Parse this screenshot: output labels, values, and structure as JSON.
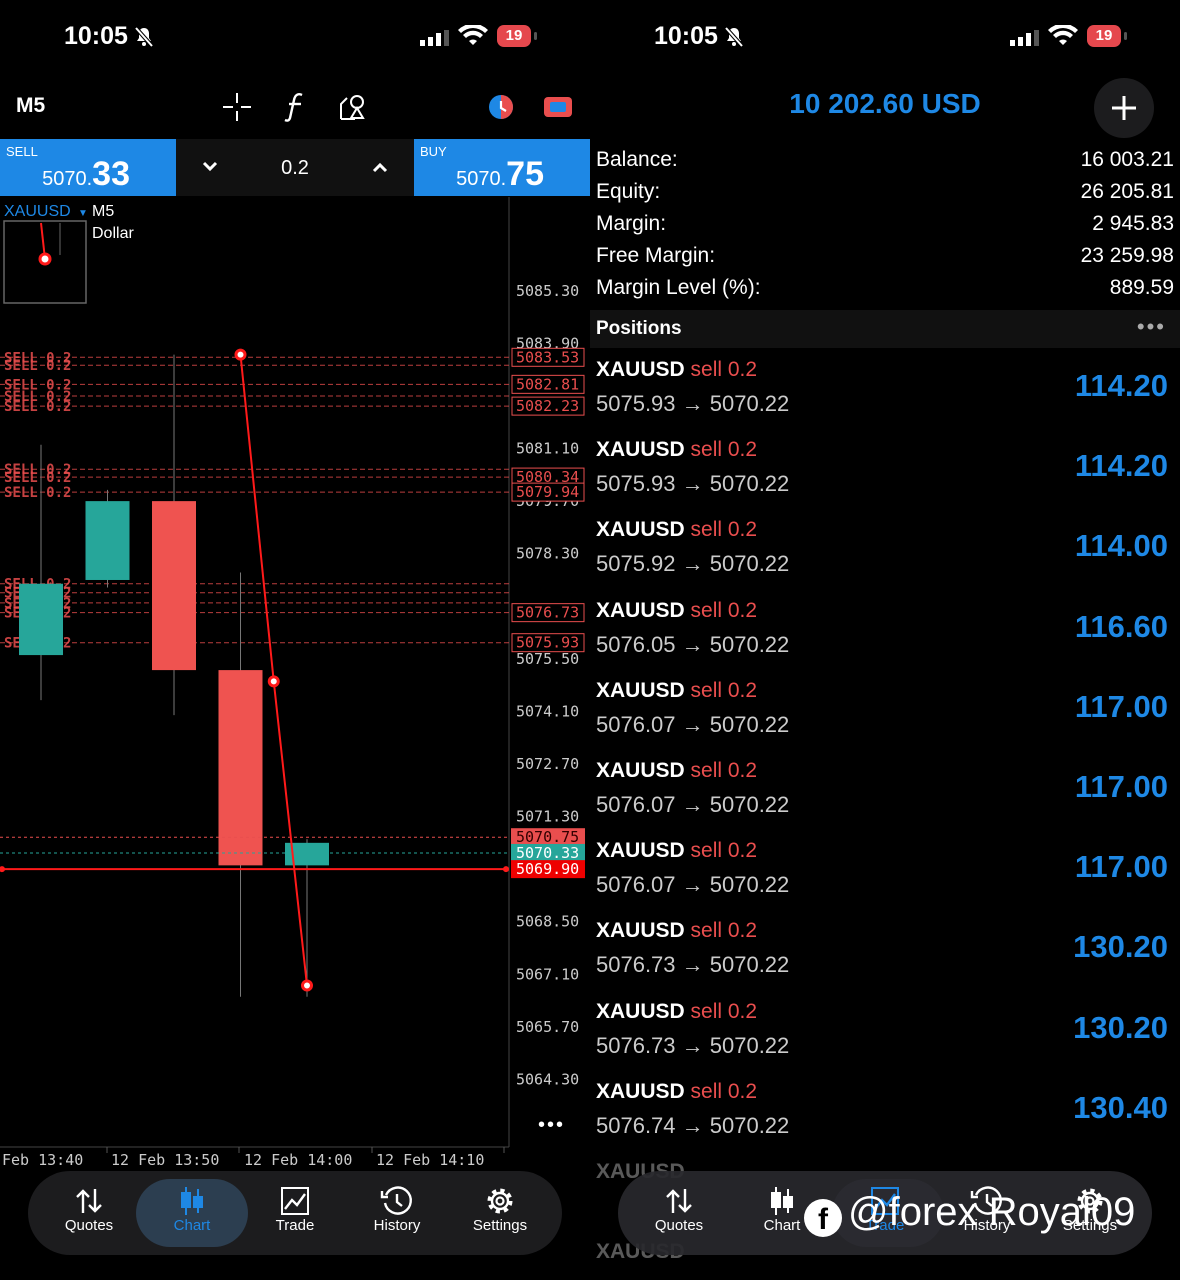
{
  "status": {
    "time": "10:05",
    "battery": "19"
  },
  "chart_screen": {
    "timeframe": "M5",
    "sell": {
      "label": "SELL",
      "price_small": "5070.",
      "price_big": "33"
    },
    "buy": {
      "label": "BUY",
      "price_small": "5070.",
      "price_big": "75"
    },
    "volume": "0.2",
    "symbol": "XAUUSD",
    "symbol_tf": "M5",
    "symbol_desc": "Dollar",
    "more": "•••"
  },
  "chart_data": {
    "type": "candlestick",
    "symbol": "XAUUSD",
    "timeframe": "M5",
    "y_ticks": [
      "5085.30",
      "5083.90",
      "5081.10",
      "5079.70",
      "5078.30",
      "5075.50",
      "5074.10",
      "5072.70",
      "5071.30",
      "5068.50",
      "5067.10",
      "5065.70",
      "5064.30"
    ],
    "x_ticks": [
      "Feb 13:40",
      "12 Feb 13:50",
      "12 Feb 14:00",
      "12 Feb 14:10"
    ],
    "ylim": [
      5062.5,
      5087.0
    ],
    "candles": [
      {
        "open": 5075.6,
        "high": 5081.2,
        "low": 5074.4,
        "close": 5077.5
      },
      {
        "open": 5077.6,
        "high": 5080.0,
        "low": 5077.4,
        "close": 5079.7
      },
      {
        "open": 5079.7,
        "high": 5083.6,
        "low": 5074.0,
        "close": 5075.2
      },
      {
        "open": 5075.2,
        "high": 5077.8,
        "low": 5066.5,
        "close": 5070.0
      },
      {
        "open": 5070.0,
        "high": 5070.7,
        "low": 5066.5,
        "close": 5070.6
      }
    ],
    "order_lines": [
      {
        "label": "SELL 0.2",
        "price": 5083.53,
        "tag": "5083.53"
      },
      {
        "label": "SELL 0.2",
        "price": 5083.32,
        "tag": ""
      },
      {
        "label": "SELL 0.2",
        "price": 5082.81,
        "tag": "5082.81"
      },
      {
        "label": "SELL 0.2",
        "price": 5082.5,
        "tag": ""
      },
      {
        "label": "SELL 0.2",
        "price": 5082.23,
        "tag": "5082.23"
      },
      {
        "label": "SELL 0.2",
        "price": 5080.55,
        "tag": ""
      },
      {
        "label": "SELL 0.2",
        "price": 5080.34,
        "tag": "5080.34"
      },
      {
        "label": "SELL 0.2",
        "price": 5079.94,
        "tag": "5079.94"
      },
      {
        "label": "SELL 0.2",
        "price": 5077.5,
        "tag": ""
      },
      {
        "label": "SELL 0.2",
        "price": 5077.26,
        "tag": ""
      },
      {
        "label": "SELL 0.2",
        "price": 5076.99,
        "tag": ""
      },
      {
        "label": "SELL 0.2",
        "price": 5076.73,
        "tag": "5076.73"
      },
      {
        "label": "SELL 0.2",
        "price": 5075.93,
        "tag": "5075.93"
      }
    ],
    "ask": {
      "price": 5070.75,
      "tag": "5070.75"
    },
    "bid": {
      "price": 5070.33,
      "tag": "5070.33"
    },
    "level": {
      "price": 5069.9,
      "tag": "5069.90"
    },
    "trend_points": [
      {
        "bar": 3.0,
        "price": 5083.6
      },
      {
        "bar": 3.5,
        "price": 5074.9
      },
      {
        "bar": 4.0,
        "price": 5066.8
      }
    ]
  },
  "nav": [
    {
      "label": "Quotes",
      "icon": "arrows-updown-icon"
    },
    {
      "label": "Chart",
      "icon": "candles-icon"
    },
    {
      "label": "Trade",
      "icon": "trend-chart-icon"
    },
    {
      "label": "History",
      "icon": "clock-history-icon"
    },
    {
      "label": "Settings",
      "icon": "gear-icon"
    }
  ],
  "trade_screen": {
    "account": "10 202.60 USD",
    "summary": [
      {
        "label": "Balance:",
        "value": "16 003.21"
      },
      {
        "label": "Equity:",
        "value": "26 205.81"
      },
      {
        "label": "Margin:",
        "value": "2 945.83"
      },
      {
        "label": "Free Margin:",
        "value": "23 259.98"
      },
      {
        "label": "Margin Level (%):",
        "value": "889.59"
      }
    ],
    "positions_title": "Positions",
    "positions": [
      {
        "symbol": "XAUUSD",
        "side": "sell 0.2",
        "prices": "5075.93 → 5070.22",
        "profit": "114.20"
      },
      {
        "symbol": "XAUUSD",
        "side": "sell 0.2",
        "prices": "5075.93 → 5070.22",
        "profit": "114.20"
      },
      {
        "symbol": "XAUUSD",
        "side": "sell 0.2",
        "prices": "5075.92 → 5070.22",
        "profit": "114.00"
      },
      {
        "symbol": "XAUUSD",
        "side": "sell 0.2",
        "prices": "5076.05 → 5070.22",
        "profit": "116.60"
      },
      {
        "symbol": "XAUUSD",
        "side": "sell 0.2",
        "prices": "5076.07 → 5070.22",
        "profit": "117.00"
      },
      {
        "symbol": "XAUUSD",
        "side": "sell 0.2",
        "prices": "5076.07 → 5070.22",
        "profit": "117.00"
      },
      {
        "symbol": "XAUUSD",
        "side": "sell 0.2",
        "prices": "5076.07 → 5070.22",
        "profit": "117.00"
      },
      {
        "symbol": "XAUUSD",
        "side": "sell 0.2",
        "prices": "5076.73 → 5070.22",
        "profit": "130.20"
      },
      {
        "symbol": "XAUUSD",
        "side": "sell 0.2",
        "prices": "5076.73 → 5070.22",
        "profit": "130.20"
      },
      {
        "symbol": "XAUUSD",
        "side": "sell 0.2",
        "prices": "5076.74 → 5070.22",
        "profit": "130.40"
      }
    ],
    "watermark": "@forex Royal09"
  },
  "colors": {
    "accent": "#1e88e5",
    "sell_red": "#e94e4e",
    "bull": "#26a69a",
    "bear": "#ef5350"
  }
}
